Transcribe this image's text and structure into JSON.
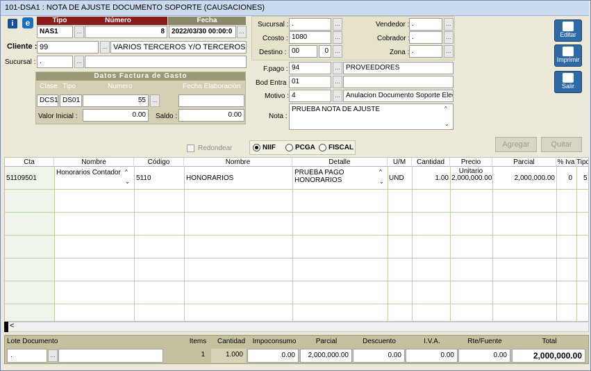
{
  "window": {
    "title": "101-DSA1 : NOTA DE AJUSTE DOCUMENTO SOPORTE (CAUSACIONES)"
  },
  "header": {
    "tipo_label": "Tipo",
    "numero_label": "Número",
    "fecha_label": "Fecha",
    "tipo_value": "NAS1",
    "numero_value": "8",
    "fecha_value": "2022/03/30 00:00:0",
    "cliente_label": "Cliente :",
    "cliente_code": "99",
    "cliente_name": "VARIOS TERCEROS Y/O TERCEROS VARI",
    "sucursal_label": "Sucursal :",
    "sucursal_value": "."
  },
  "factura_gasto": {
    "title": "Datos Factura de Gasto",
    "clase_label": "Clase",
    "tipo_label": "Tipo",
    "numero_label": "Numero",
    "fecha_label": "Fecha Elaboración",
    "clase_value": "DCS1",
    "tipo_value": "DS01",
    "numero_value": "55",
    "fecha_value": "",
    "valor_inicial_label": "Valor Inicial :",
    "valor_inicial": "0.00",
    "saldo_label": "Saldo :",
    "saldo": "0.00"
  },
  "mid": {
    "sucursal_label": "Sucursal :",
    "sucursal": ".",
    "ccosto_label": "Ccosto :",
    "ccosto": "1080",
    "destino_label": "Destino :",
    "destino": "00",
    "destino2": "0",
    "vendedor_label": "Vendedor :",
    "vendedor": ".",
    "cobrador_label": "Cobrador :",
    "cobrador": ".",
    "zona_label": "Zona :",
    "zona": ".",
    "fpago_label": "F.pago :",
    "fpago": "94",
    "fpago_desc": "PROVEEDORES",
    "bodentra_label": "Bod Entra :",
    "bodentra": "01",
    "bodentra_desc": "",
    "motivo_label": "Motivo :",
    "motivo": "4",
    "motivo_desc": "Anulacion Documento Soporte Electro",
    "nota_label": "Nota :",
    "nota": "PRUEBA NOTA DE AJUSTE"
  },
  "side_buttons": {
    "editar": "Editar",
    "imprimir": "Imprimir",
    "salir": "Salir"
  },
  "options": {
    "redondear": "Redondear",
    "niif": "NIIF",
    "pcga": "PCGA",
    "fiscal": "FISCAL",
    "selected": "NIIF"
  },
  "actions": {
    "agregar": "Agregar",
    "quitar": "Quitar"
  },
  "grid": {
    "columns": [
      "Cta",
      "Nombre",
      "Código",
      "Nombre",
      "Detalle",
      "U/M",
      "Cantidad",
      "Precio Unitario",
      "Parcial",
      "% Iva",
      "Tipo"
    ],
    "rows": [
      {
        "cta": "51109501",
        "nombre": "Honorarios Contador",
        "codigo": "5110",
        "nombre2": "HONORARIOS",
        "detalle1": "PRUEBA PAGO",
        "detalle2": "HONORARIOS",
        "um": "UND",
        "cantidad": "1.00",
        "precio": "2,000,000.00",
        "parcial": "2,000,000.00",
        "iva": "0",
        "tipo": "5"
      }
    ],
    "scroll_left": "<"
  },
  "footer": {
    "lote_label": "Lote Documento",
    "lote_value": ".",
    "items_label": "Items",
    "items": "1",
    "cantidad_label": "Cantidad",
    "cantidad": "1.000",
    "impoconsumo_label": "Impoconsumo",
    "impoconsumo": "0.00",
    "parcial_label": "Parcial",
    "parcial": "2,000,000.00",
    "descuento_label": "Descuento",
    "descuento": "0.00",
    "iva_label": "I.V.A.",
    "iva": "0.00",
    "rtefuente_label": "Rte/Fuente",
    "rtefuente": "0.00",
    "total_label": "Total",
    "total": "2,000,000.00"
  }
}
